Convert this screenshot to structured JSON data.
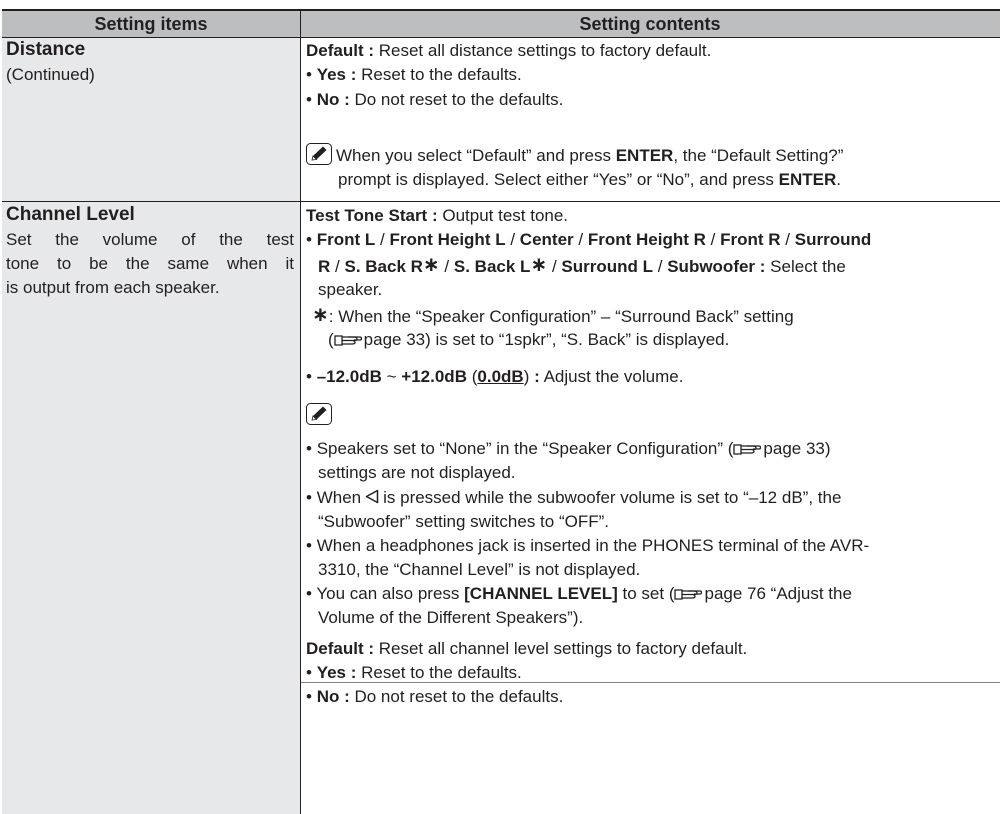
{
  "header": {
    "col1": "Setting items",
    "col2": "Setting contents"
  },
  "distance": {
    "title": "Distance",
    "continued": "(Continued)",
    "default_label": "Default :",
    "default_text": "Reset all distance settings to factory default.",
    "yes_label": "Yes :",
    "yes_text": "Reset to the defaults.",
    "no_label": "No :",
    "no_text": "Do not reset to the defaults.",
    "note1_a": "When you select “Default” and press",
    "note1_b": "ENTER",
    "note1_c": ", the “Default Setting?”",
    "note2_a": "prompt is displayed. Select either “Yes” or “No”, and press",
    "note2_b": "ENTER",
    "note2_c": "."
  },
  "channel": {
    "title": "Channel Level",
    "desc1": "Set the volume of the test",
    "desc2": "tone to be the same when it",
    "desc3": "is output from each speaker.",
    "test_label": "Test Tone Start :",
    "test_text": "Output test tone.",
    "spk_front_l": "Front L",
    "spk_front_height_l": "Front Height L",
    "spk_center": "Center",
    "spk_front_height_r": "Front Height R",
    "spk_front_r": "Front R",
    "spk_surround": "Surround",
    "spk_surround_r": "R",
    "spk_sback_r": "S. Back R",
    "spk_sback_l": "S. Back L",
    "spk_surround_l": "Surround L",
    "spk_subwoofer": "Subwoofer :",
    "slash": "/",
    "star": "∗",
    "select_the": "Select the",
    "speaker_end": "speaker.",
    "footnote_mark": "∗",
    "footnote1_a": ": When the “Speaker Configuration” – “Surround Back” setting",
    "footnote2_a": "page 33) is set to “1spkr”, “S. Back” is displayed.",
    "paren_open": "(",
    "range_min": "–12.0dB",
    "range_tilde": "~",
    "range_max": "+12.0dB",
    "range_default": "0.0dB",
    "paren_close": ")",
    "colon": ":",
    "range_text": "Adjust the volume.",
    "n1_l1_a": "Speakers set to “None” in the “Speaker Configuration” (",
    "n1_l1_b": "page 33)",
    "n1_l2": "settings are not displayed.",
    "n2_l1_a": "When",
    "n2_l1_b": "is pressed while the subwoofer volume is set to “–12 dB”, the",
    "n2_l2": "“Subwoofer” setting switches to “OFF”.",
    "n3_l1": "When a headphones jack is inserted in the PHONES terminal of the AVR-",
    "n3_l2": "3310, the “Channel Level” is not displayed.",
    "n4_l1_a": "You can also press",
    "n4_l1_b": "[CHANNEL LEVEL]",
    "n4_l1_c": "to set (",
    "n4_l1_d": "page 76 “Adjust the",
    "n4_l2": "Volume of the Different Speakers”).",
    "default_label": "Default :",
    "default_text": "Reset all channel level settings to factory default.",
    "yes_label": "Yes :",
    "yes_text": "Reset to the defaults.",
    "no_label": "No :",
    "no_text": "Do not reset to the defaults."
  },
  "bullet": "•",
  "icons": {
    "note": "pencil-icon",
    "reference": "pointing-hand-icon",
    "left": "left-triangle-icon"
  }
}
